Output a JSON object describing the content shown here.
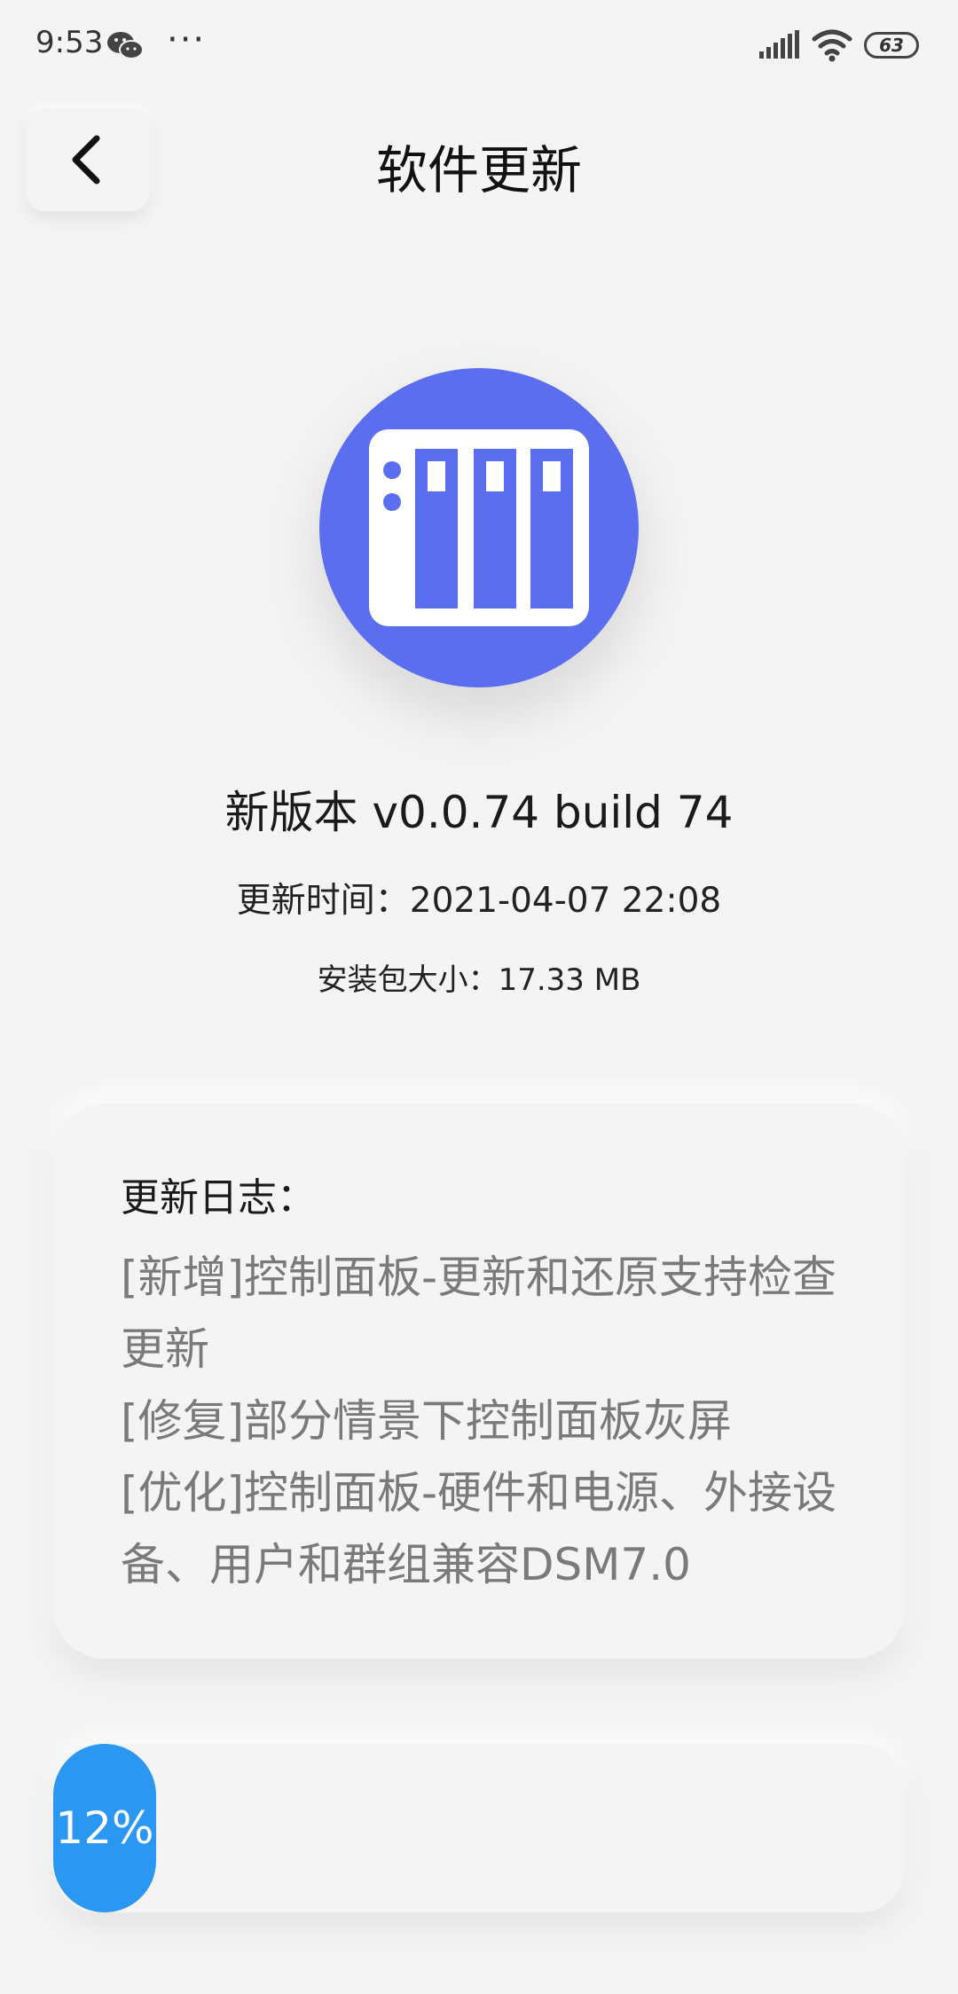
{
  "status_bar": {
    "time": "9:53",
    "more": "···",
    "battery": "63"
  },
  "header": {
    "title": "软件更新",
    "back_icon": "chevron-left-icon"
  },
  "app_icon": {
    "name": "nas-server-icon",
    "color": "#5a6eef"
  },
  "version": {
    "label": "新版本 v0.0.74 build 74",
    "update_time": "更新时间：2021-04-07 22:08",
    "package_size": "安装包大小：17.33 MB"
  },
  "changelog": {
    "title": "更新日志：",
    "lines": [
      "[新增]控制面板-更新和还原支持检查更新",
      "[修复]部分情景下控制面板灰屏",
      "[优化]控制面板-硬件和电源、外接设备、用户和群组兼容DSM7.0"
    ]
  },
  "progress": {
    "percent": 12,
    "label": "12%",
    "color": "#2a97f2"
  }
}
